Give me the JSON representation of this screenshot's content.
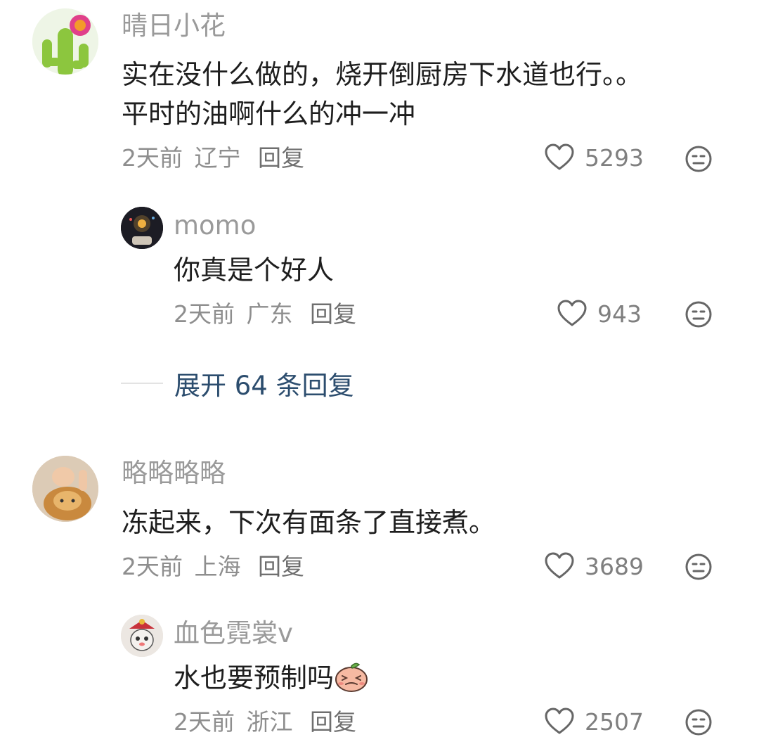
{
  "comments": [
    {
      "user": "晴日小花",
      "text_line1": "实在没什么做的，烧开倒厨房下水道也行。。",
      "text_line2": "平时的油啊什么的冲一冲",
      "time": "2天前",
      "location": "辽宁",
      "reply_label": "回复",
      "likes": "5293",
      "avatar_icon": "cactus-avatar"
    },
    {
      "user": "momo",
      "text": "你真是个好人",
      "time": "2天前",
      "location": "广东",
      "reply_label": "回复",
      "likes": "943",
      "avatar_icon": "night-lamp-avatar"
    },
    {
      "user": "略略略略",
      "text": "冻起来，下次有面条了直接煮。",
      "time": "2天前",
      "location": "上海",
      "reply_label": "回复",
      "likes": "3689",
      "avatar_icon": "cat-avatar"
    },
    {
      "user": "血色霓裳v",
      "text": "水也要预制吗",
      "time": "2天前",
      "location": "浙江",
      "reply_label": "回复",
      "likes": "2507",
      "avatar_icon": "opera-mask-cat-avatar",
      "inline_emoji": "peach-face-emoji"
    }
  ],
  "expand_replies": {
    "label": "展开 64 条回复"
  },
  "colors": {
    "username": "#9a9a9a",
    "text": "#1e1e1e",
    "meta": "#8e8e8e",
    "link": "#2c4d6e",
    "icon": "#666666"
  }
}
